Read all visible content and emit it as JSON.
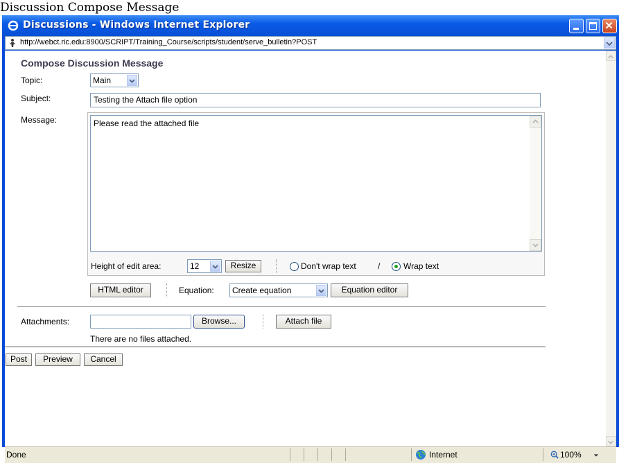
{
  "page_caption": "Discussion Compose Message",
  "window": {
    "title": "Discussions - Windows Internet Explorer",
    "url": "http://webct.ric.edu:8900/SCRIPT/Training_Course/scripts/student/serve_bulletin?POST"
  },
  "form": {
    "heading": "Compose Discussion Message",
    "topic_label": "Topic:",
    "topic_value": "Main",
    "subject_label": "Subject:",
    "subject_value": "Testing the Attach file option",
    "message_label": "Message:",
    "message_value": "Please read the attached file",
    "height_label": "Height of edit area:",
    "height_value": "12",
    "resize_button": "Resize",
    "nowrap_label": "Don't wrap text",
    "wrap_sep": "/",
    "wrap_label": "Wrap text",
    "html_editor_button": "HTML editor",
    "equation_label": "Equation:",
    "equation_value": "Create equation",
    "equation_editor_button": "Equation editor",
    "attachments_label": "Attachments:",
    "attachments_value": "",
    "browse_button": "Browse...",
    "attach_button": "Attach file",
    "no_files_text": "There are no files attached.",
    "post_button": "Post",
    "preview_button": "Preview",
    "cancel_button": "Cancel"
  },
  "status": {
    "text": "Done",
    "zone": "Internet",
    "zoom": "100%"
  },
  "colors": {
    "titlebar": "#0a5ae6",
    "heading": "#3c3c50"
  }
}
